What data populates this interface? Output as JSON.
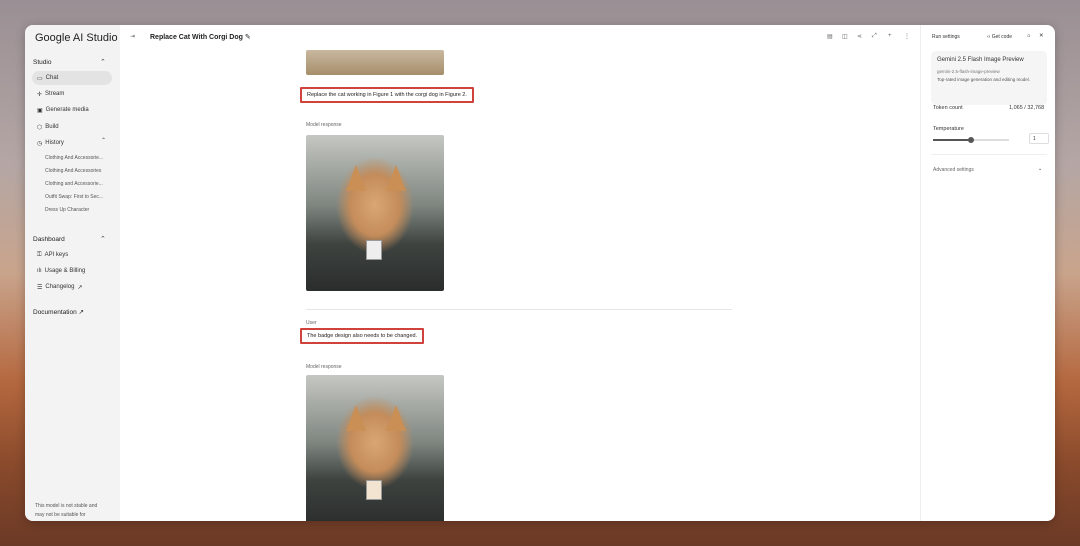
{
  "sidebar": {
    "logo": "Google AI Studio",
    "studio": "Studio",
    "items": [
      {
        "label": "Chat",
        "icon": "chat-icon"
      },
      {
        "label": "Stream",
        "icon": "stream-icon"
      },
      {
        "label": "Generate media",
        "icon": "media-icon"
      },
      {
        "label": "Build",
        "icon": "build-icon"
      },
      {
        "label": "History",
        "icon": "history-icon"
      }
    ],
    "history": [
      "Clothing And Accessorie...",
      "Clothing And Accessories",
      "Clothing and Accessorie...",
      "Outfit Swap: First to Sec...",
      "Dress Up Character"
    ],
    "dashboard": "Dashboard",
    "dash_items": [
      {
        "label": "API keys"
      },
      {
        "label": "Usage & Billing"
      },
      {
        "label": "Changelog"
      }
    ],
    "documentation": "Documentation",
    "footer": [
      "This model is not stable and",
      "may not be suitable for"
    ]
  },
  "header": {
    "title": "Replace Cat With Corgi Dog"
  },
  "chat": {
    "msg1": "Replace the cat working in Figure 1 with the corgi dog in Figure 2.",
    "model_label": "Model response",
    "user_label": "User",
    "msg2": "The badge design also needs to be changed."
  },
  "run": {
    "title": "Run settings",
    "get_code": "Get code",
    "model_name": "Gemini 2.5 Flash Image Preview",
    "model_id": "gemini-2.5-flash-image-preview",
    "model_desc": "Top-rated image generation and editing model.",
    "token_label": "Token count",
    "token_value": "1,065 / 32,768",
    "temp_label": "Temperature",
    "temp_value": "1",
    "temperature": 1,
    "advanced": "Advanced settings"
  },
  "colors": {
    "highlight": "#d0433d"
  }
}
